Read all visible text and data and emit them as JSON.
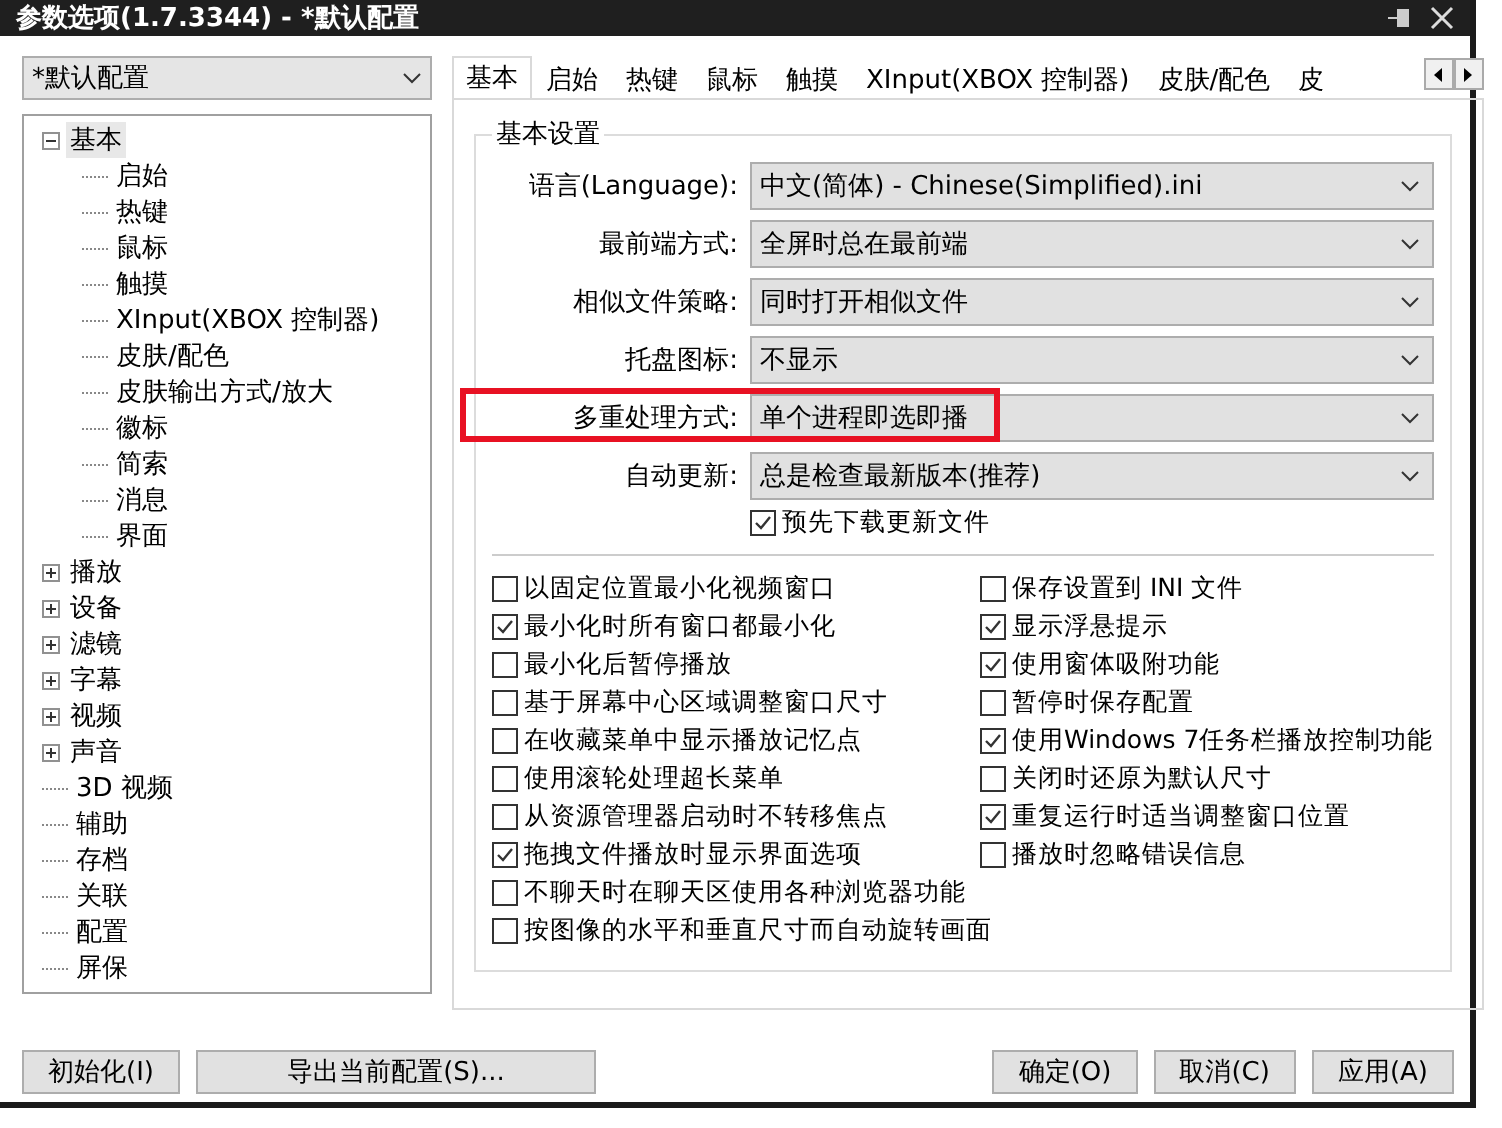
{
  "window": {
    "title": "参数选项(1.7.3344) - *默认配置"
  },
  "profile_select": {
    "value": "*默认配置"
  },
  "tree": [
    {
      "label": "基本",
      "kind": "group",
      "expanded": true,
      "selected": true,
      "children": [
        {
          "label": "启始"
        },
        {
          "label": "热键"
        },
        {
          "label": "鼠标"
        },
        {
          "label": "触摸"
        },
        {
          "label": "XInput(XBOX 控制器)"
        },
        {
          "label": "皮肤/配色"
        },
        {
          "label": "皮肤输出方式/放大"
        },
        {
          "label": "徽标"
        },
        {
          "label": "简索"
        },
        {
          "label": "消息"
        },
        {
          "label": "界面"
        }
      ]
    },
    {
      "label": "播放",
      "kind": "group",
      "expanded": false,
      "selected": false
    },
    {
      "label": "设备",
      "kind": "group",
      "expanded": false,
      "selected": false
    },
    {
      "label": "滤镜",
      "kind": "group",
      "expanded": false,
      "selected": false
    },
    {
      "label": "字幕",
      "kind": "group",
      "expanded": false,
      "selected": false
    },
    {
      "label": "视频",
      "kind": "group",
      "expanded": false,
      "selected": false
    },
    {
      "label": "声音",
      "kind": "group",
      "expanded": false,
      "selected": false
    },
    {
      "label": "3D 视频",
      "kind": "leaf",
      "selected": false
    },
    {
      "label": "辅助",
      "kind": "leaf",
      "selected": false
    },
    {
      "label": "存档",
      "kind": "leaf",
      "selected": false
    },
    {
      "label": "关联",
      "kind": "leaf",
      "selected": false
    },
    {
      "label": "配置",
      "kind": "leaf",
      "selected": false
    },
    {
      "label": "屏保",
      "kind": "leaf",
      "selected": false
    }
  ],
  "tabs": [
    {
      "label": "基本",
      "selected": true
    },
    {
      "label": "启始",
      "selected": false
    },
    {
      "label": "热键",
      "selected": false
    },
    {
      "label": "鼠标",
      "selected": false
    },
    {
      "label": "触摸",
      "selected": false
    },
    {
      "label": "XInput(XBOX 控制器)",
      "selected": false
    },
    {
      "label": "皮肤/配色",
      "selected": false
    },
    {
      "label": "皮",
      "selected": false
    }
  ],
  "group": {
    "title": "基本设置",
    "rows": [
      {
        "label": "语言(Language):",
        "value": "中文(简体) - Chinese(Simplified).ini",
        "highlighted": false
      },
      {
        "label": "最前端方式:",
        "value": "全屏时总在最前端",
        "highlighted": false
      },
      {
        "label": "相似文件策略:",
        "value": "同时打开相似文件",
        "highlighted": false
      },
      {
        "label": "托盘图标:",
        "value": "不显示",
        "highlighted": false
      },
      {
        "label": "多重处理方式:",
        "value": "单个进程即选即播",
        "highlighted": true
      },
      {
        "label": "自动更新:",
        "value": "总是检查最新版本(推荐)",
        "highlighted": false
      }
    ],
    "predownload": {
      "label": "预先下载更新文件",
      "checked": true
    },
    "options_left": [
      {
        "label": "以固定位置最小化视频窗口",
        "checked": false
      },
      {
        "label": "最小化时所有窗口都最小化",
        "checked": true
      },
      {
        "label": "最小化后暂停播放",
        "checked": false
      },
      {
        "label": "基于屏幕中心区域调整窗口尺寸",
        "checked": false
      },
      {
        "label": "在收藏菜单中显示播放记忆点",
        "checked": false
      },
      {
        "label": "使用滚轮处理超长菜单",
        "checked": false
      },
      {
        "label": "从资源管理器启动时不转移焦点",
        "checked": false
      },
      {
        "label": "拖拽文件播放时显示界面选项",
        "checked": true
      },
      {
        "label": "不聊天时在聊天区使用各种浏览器功能",
        "checked": false
      },
      {
        "label": "按图像的水平和垂直尺寸而自动旋转画面",
        "checked": false
      }
    ],
    "options_right": [
      {
        "label": "保存设置到 INI 文件",
        "checked": false
      },
      {
        "label": "显示浮悬提示",
        "checked": true
      },
      {
        "label": "使用窗体吸附功能",
        "checked": true
      },
      {
        "label": "暂停时保存配置",
        "checked": false
      },
      {
        "label": "使用Windows 7任务栏播放控制功能",
        "checked": true
      },
      {
        "label": "关闭时还原为默认尺寸",
        "checked": false
      },
      {
        "label": "重复运行时适当调整窗口位置",
        "checked": true
      },
      {
        "label": "播放时忽略错误信息",
        "checked": false
      }
    ]
  },
  "buttons_left": [
    "初始化(I)",
    "导出当前配置(S)..."
  ],
  "buttons_right": [
    "确定(O)",
    "取消(C)",
    "应用(A)"
  ]
}
